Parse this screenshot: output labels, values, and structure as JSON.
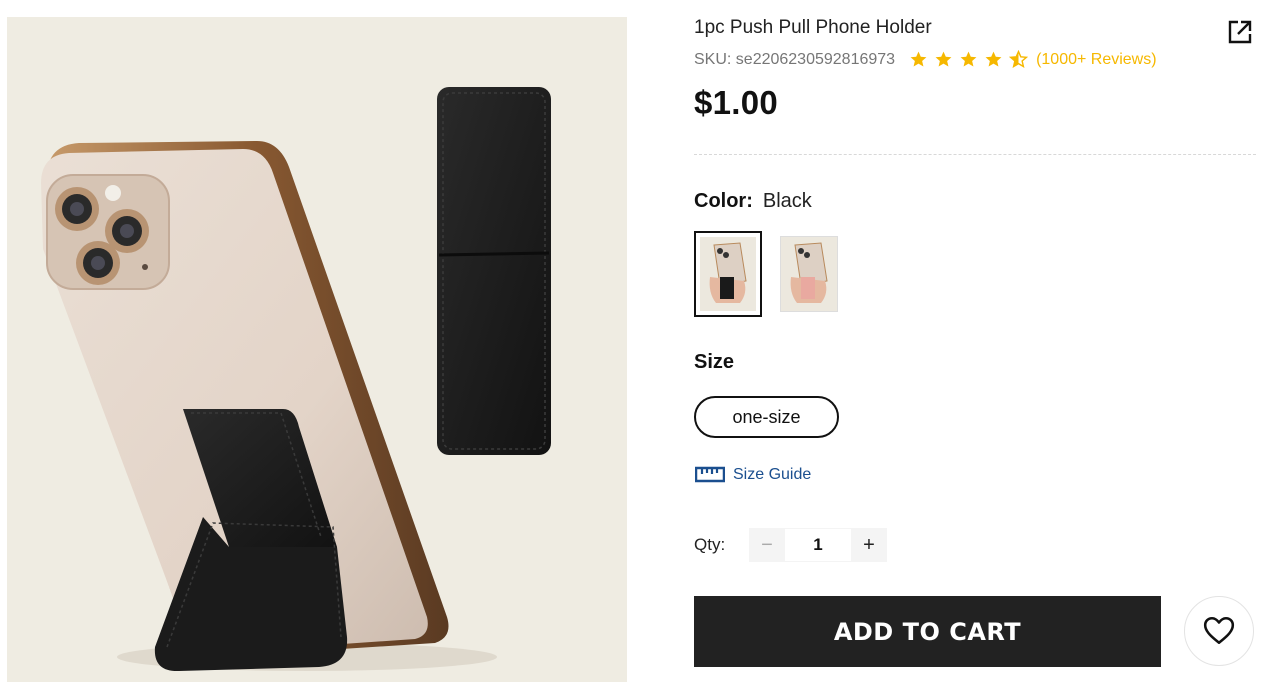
{
  "product": {
    "title": "1pc Push Pull Phone Holder",
    "sku": "SKU: se2206230592816973",
    "rating": 4.5,
    "reviews": "(1000+ Reviews)",
    "price": "$1.00",
    "image_icon": "phone-holder-product-photo",
    "share_icon": "share-external-icon"
  },
  "color": {
    "label": "Color:",
    "selected": "Black",
    "swatches": [
      {
        "name": "Black",
        "selected": true,
        "tone": "#1d1d1d"
      },
      {
        "name": "Pink",
        "selected": false,
        "tone": "#e9a9a0"
      }
    ]
  },
  "size": {
    "label": "Size",
    "options": [
      "one-size"
    ],
    "guide": "Size Guide",
    "guide_icon": "ruler-icon"
  },
  "quantity": {
    "label": "Qty:",
    "value": "1",
    "minus": "−",
    "plus": "+"
  },
  "actions": {
    "add_to_cart": "ADD TO CART",
    "wishlist_icon": "heart-icon"
  },
  "colors": {
    "star": "#f6b800",
    "button_bg": "#222222",
    "link": "#1b4f8f",
    "image_bg": "#efece2"
  }
}
